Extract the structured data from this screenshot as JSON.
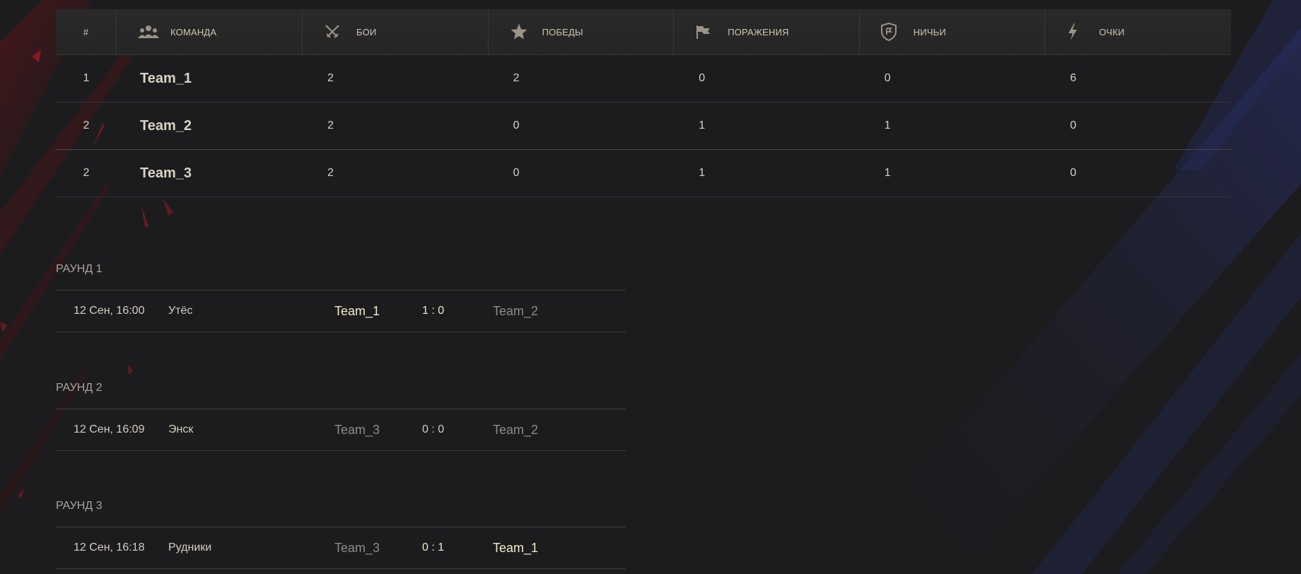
{
  "standings": {
    "headers": {
      "rank": "#",
      "team": "КОМАНДА",
      "battles": "БОИ",
      "wins": "ПОБЕДЫ",
      "losses": "ПОРАЖЕНИЯ",
      "draws": "НИЧЬИ",
      "points": "ОЧКИ"
    },
    "icons": {
      "team": "team-icon",
      "battles": "crossed-swords-icon",
      "wins": "star-icon",
      "losses": "flag-icon",
      "draws": "shield-icon",
      "points": "lightning-icon"
    },
    "rows": [
      {
        "rank": "1",
        "team": "Team_1",
        "battles": "2",
        "wins": "2",
        "losses": "0",
        "draws": "0",
        "points": "6"
      },
      {
        "rank": "2",
        "team": "Team_2",
        "battles": "2",
        "wins": "0",
        "losses": "1",
        "draws": "1",
        "points": "0"
      },
      {
        "rank": "2",
        "team": "Team_3",
        "battles": "2",
        "wins": "0",
        "losses": "1",
        "draws": "1",
        "points": "0"
      }
    ]
  },
  "rounds": [
    {
      "title": "РАУНД 1",
      "match": {
        "date": "12 Сен, 16:00",
        "map": "Утёс",
        "home": "Team_1",
        "score": "1 : 0",
        "away": "Team_2"
      }
    },
    {
      "title": "РАУНД 2",
      "match": {
        "date": "12 Сен, 16:09",
        "map": "Энск",
        "home": "Team_3",
        "score": "0 : 0",
        "away": "Team_2"
      }
    },
    {
      "title": "РАУНД 3",
      "match": {
        "date": "12 Сен, 16:18",
        "map": "Рудники",
        "home": "Team_3",
        "score": "0 : 1",
        "away": "Team_1"
      }
    }
  ],
  "colors": {
    "background": "#1c1c1e",
    "header_bg": "#282728",
    "text": "#d6d1c3",
    "winner": "#f3ebc9",
    "loser": "#8f8b84",
    "accent_red": "#8a1a1e",
    "accent_blue": "#22285a"
  }
}
